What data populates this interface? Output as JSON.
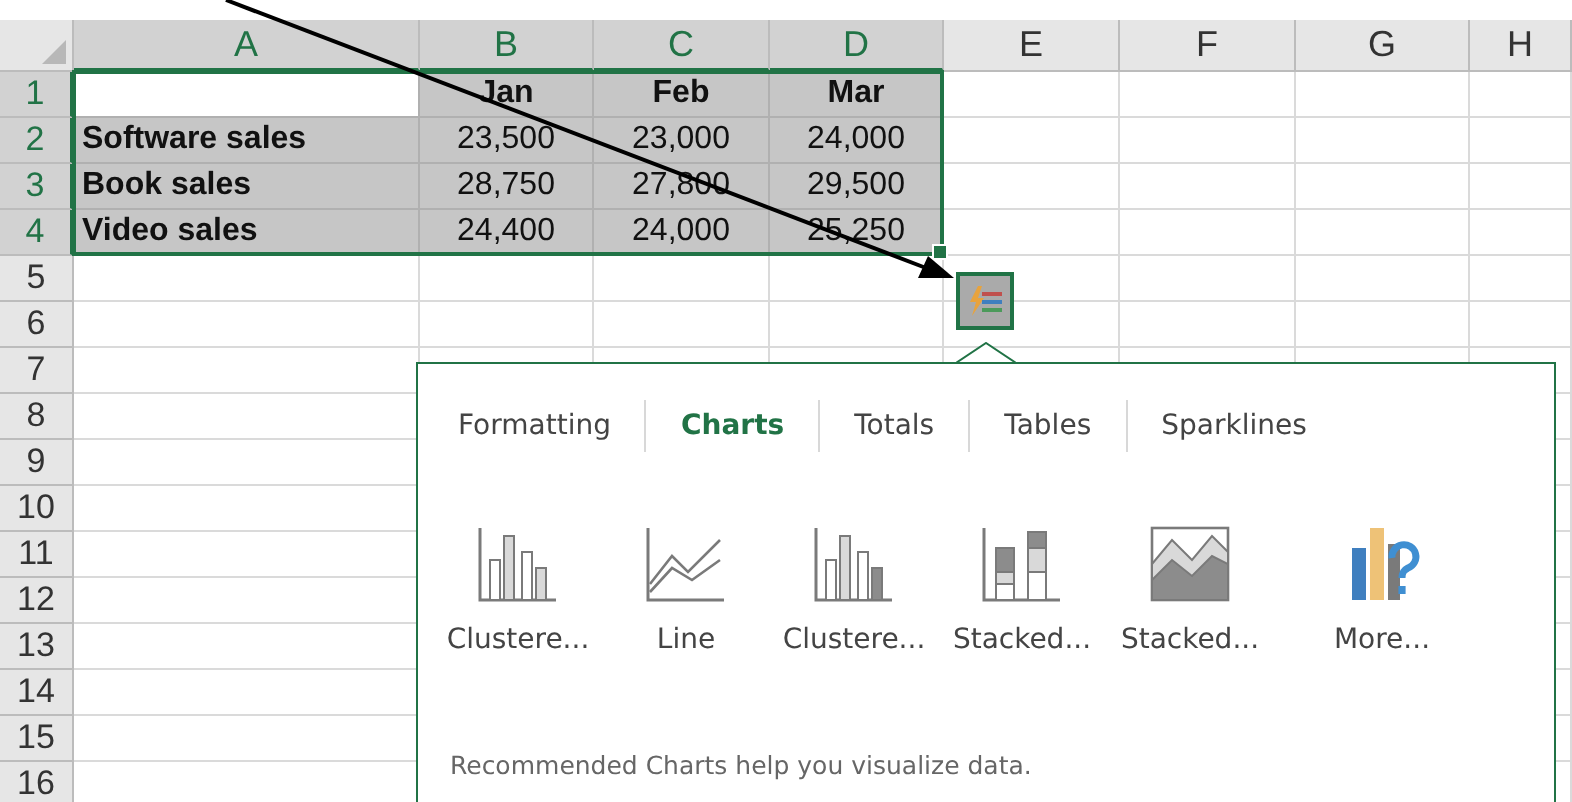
{
  "columns": [
    {
      "label": "A",
      "selected": true
    },
    {
      "label": "B",
      "selected": true
    },
    {
      "label": "C",
      "selected": true
    },
    {
      "label": "D",
      "selected": true
    },
    {
      "label": "E",
      "selected": false
    },
    {
      "label": "F",
      "selected": false
    },
    {
      "label": "G",
      "selected": false
    },
    {
      "label": "H",
      "selected": false
    }
  ],
  "rows": [
    {
      "label": "1",
      "selected": true
    },
    {
      "label": "2",
      "selected": true
    },
    {
      "label": "3",
      "selected": true
    },
    {
      "label": "4",
      "selected": true
    },
    {
      "label": "5",
      "selected": false
    },
    {
      "label": "6",
      "selected": false
    },
    {
      "label": "7",
      "selected": false
    },
    {
      "label": "8",
      "selected": false
    },
    {
      "label": "9",
      "selected": false
    },
    {
      "label": "10",
      "selected": false
    },
    {
      "label": "11",
      "selected": false
    },
    {
      "label": "12",
      "selected": false
    },
    {
      "label": "13",
      "selected": false
    },
    {
      "label": "14",
      "selected": false
    },
    {
      "label": "15",
      "selected": false
    },
    {
      "label": "16",
      "selected": false
    }
  ],
  "header_row": [
    "Jan",
    "Feb",
    "Mar"
  ],
  "data_rows": [
    {
      "label": "Software sales",
      "values": [
        "23,500",
        "23,000",
        "24,000"
      ]
    },
    {
      "label": "Book sales",
      "values": [
        "28,750",
        "27,800",
        "29,500"
      ]
    },
    {
      "label": "Video sales",
      "values": [
        "24,400",
        "24,000",
        "25,250"
      ]
    }
  ],
  "quick_analysis": {
    "expanded": true,
    "tabs": [
      {
        "label": "Formatting",
        "selected": false
      },
      {
        "label": "Charts",
        "selected": true
      },
      {
        "label": "Totals",
        "selected": false
      },
      {
        "label": "Tables",
        "selected": false
      },
      {
        "label": "Sparklines",
        "selected": false
      }
    ],
    "options": [
      {
        "kind": "clustered",
        "label": "Clustere..."
      },
      {
        "kind": "line",
        "label": "Line"
      },
      {
        "kind": "clustered_dark",
        "label": "Clustere..."
      },
      {
        "kind": "stacked",
        "label": "Stacked..."
      },
      {
        "kind": "stacked_area",
        "label": "Stacked..."
      },
      {
        "kind": "more",
        "label": "More..."
      }
    ],
    "footer": "Recommended Charts help you visualize data."
  }
}
